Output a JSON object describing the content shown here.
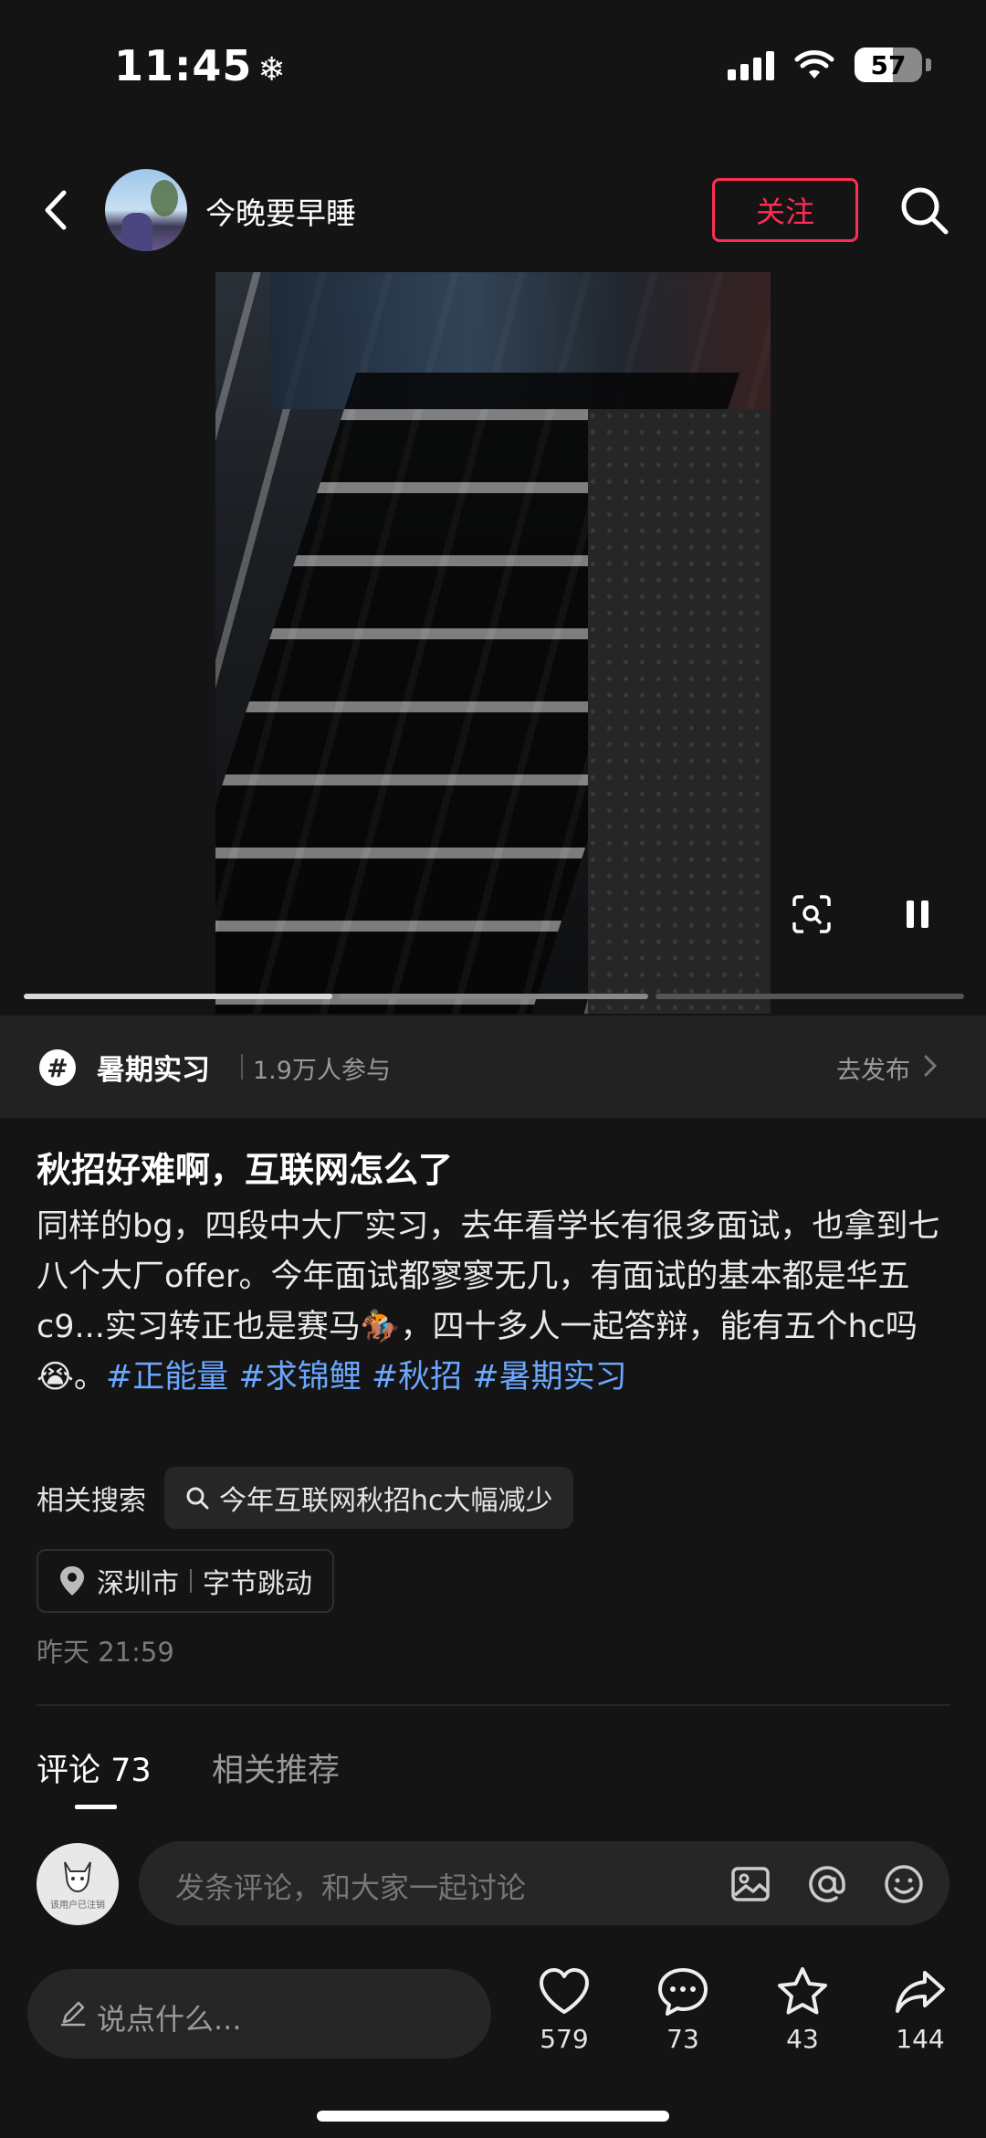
{
  "status": {
    "time": "11:45",
    "snow_icon": "snowflake-icon",
    "battery": "57"
  },
  "header": {
    "author_name": "今晚要早睡",
    "follow_label": "关注"
  },
  "media": {
    "progress_segments": 3,
    "active_segment": 1
  },
  "topic": {
    "title": "暑期实习",
    "participants": "1.9万人参与",
    "action_label": "去发布"
  },
  "post": {
    "title": "秋招好难啊，互联网怎么了",
    "body": "同样的bg，四段中大厂实习，去年看学长有很多面试，也拿到七八个大厂offer。今年面试都寥寥无几，有面试的基本都是华五c9...实习转正也是赛马🏇，四十多人一起答辩，能有五个hc吗😭。",
    "tags": [
      "#正能量",
      "#求锦鲤",
      "#秋招",
      "#暑期实习"
    ],
    "related_label": "相关搜索",
    "related_query": "今年互联网秋招hc大幅减少",
    "location_city": "深圳市",
    "location_place": "字节跳动",
    "time": "昨天 21:59"
  },
  "tabs": {
    "comments_label": "评论 73",
    "recommend_label": "相关推荐"
  },
  "comment_input": {
    "placeholder": "发条评论，和大家一起讨论",
    "avatar_caption": "该用户已注销"
  },
  "bottom": {
    "say_placeholder": "说点什么...",
    "likes": "579",
    "comments": "73",
    "favorites": "43",
    "shares": "144"
  },
  "colors": {
    "accent": "#ff2d55",
    "tag": "#6aa7ff",
    "background": "#141414"
  }
}
